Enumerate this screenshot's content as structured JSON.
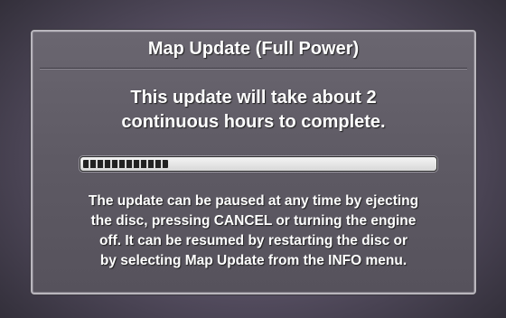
{
  "dialog": {
    "title": "Map Update (Full Power)",
    "headline_lines": [
      "This update will take about 2",
      "continuous hours to complete."
    ],
    "progress_fraction": 0.25,
    "message_lines": [
      "The update can be paused at any time by ejecting",
      "the disc, pressing CANCEL or turning the engine",
      "off. It can be resumed by restarting the disc or",
      "by selecting Map Update from the INFO menu."
    ]
  }
}
